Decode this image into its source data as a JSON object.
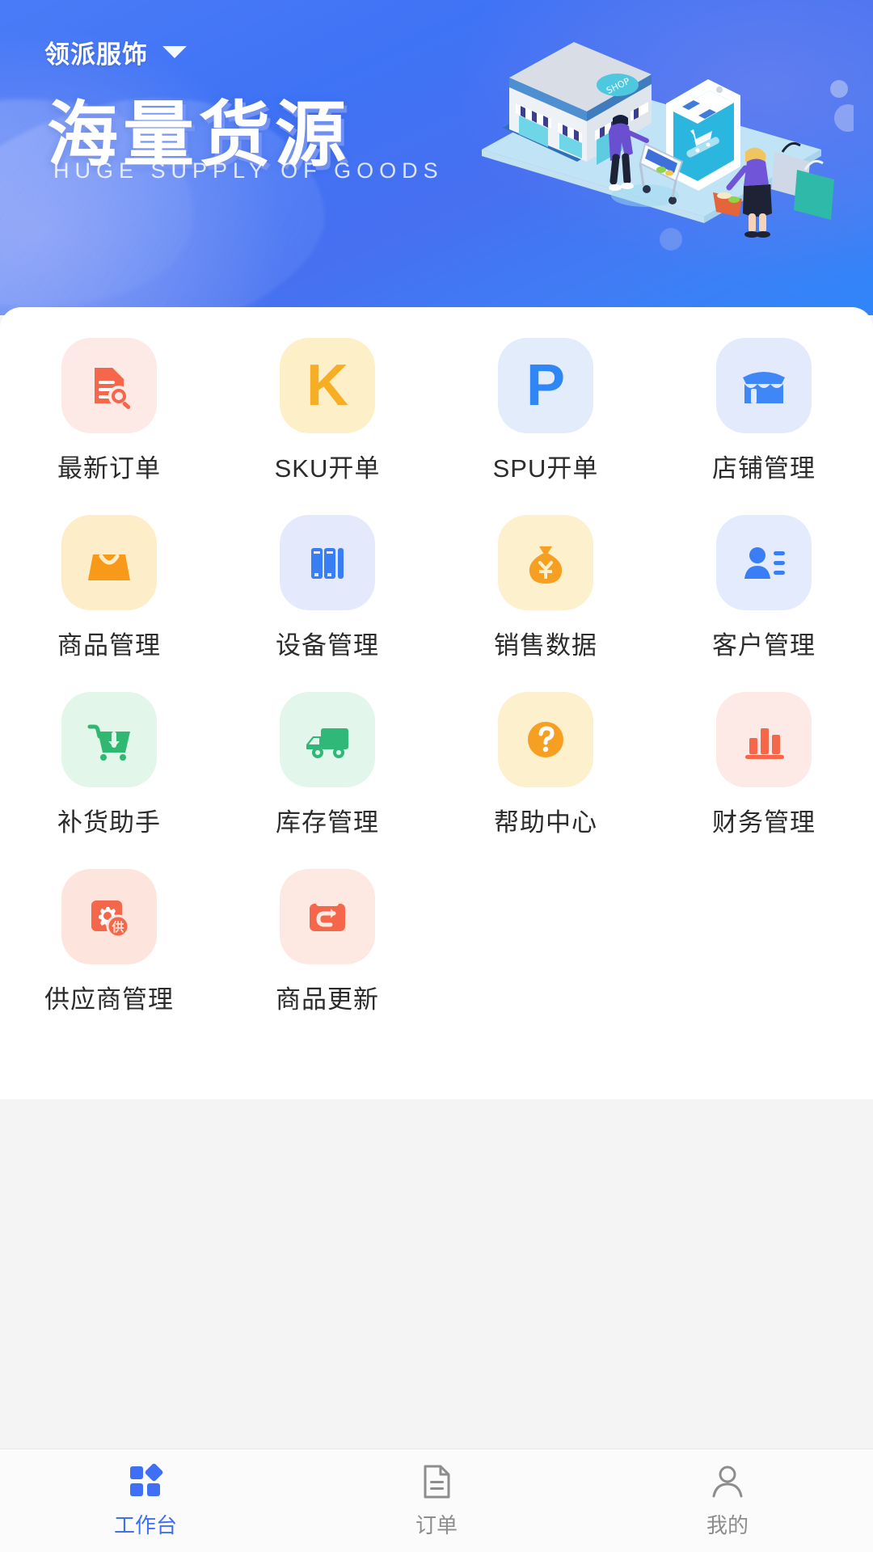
{
  "header": {
    "brand_name": "领派服饰",
    "brand_dropdown_icon": "chevron-down-icon",
    "title": "海量货源",
    "subtitle": "HUGE SUPPLY OF GOODS",
    "background_color": "#4372f3",
    "illustration": "isometric-shop-phone-shoppers"
  },
  "grid": {
    "items": [
      {
        "label": "最新订单",
        "icon": "document-search-icon",
        "icon_color": "#f5674a",
        "bg_color": "#fdeae6"
      },
      {
        "label": "SKU开单",
        "icon": "letter-k-icon",
        "icon_color": "#f7ae25",
        "bg_color": "#fdf0c8"
      },
      {
        "label": "SPU开单",
        "icon": "letter-p-icon",
        "icon_color": "#2f86f7",
        "bg_color": "#e3ecfb"
      },
      {
        "label": "店铺管理",
        "icon": "storefront-icon",
        "icon_color": "#3f86f7",
        "bg_color": "#e3eafb"
      },
      {
        "label": "商品管理",
        "icon": "shopping-bag-icon",
        "icon_color": "#f79a1a",
        "bg_color": "#fdeec9"
      },
      {
        "label": "设备管理",
        "icon": "binders-icon",
        "icon_color": "#3a7ef5",
        "bg_color": "#e4eafc"
      },
      {
        "label": "销售数据",
        "icon": "money-bag-yuan-icon",
        "icon_color": "#f79f22",
        "bg_color": "#fdf0cd"
      },
      {
        "label": "客户管理",
        "icon": "customer-contact-icon",
        "icon_color": "#3a7ef5",
        "bg_color": "#e4ebfc"
      },
      {
        "label": "补货助手",
        "icon": "cart-download-icon",
        "icon_color": "#2fb872",
        "bg_color": "#e2f6e9"
      },
      {
        "label": "库存管理",
        "icon": "delivery-truck-icon",
        "icon_color": "#2fb878",
        "bg_color": "#e2f6ec"
      },
      {
        "label": "帮助中心",
        "icon": "question-mark-icon",
        "icon_color": "#f79f22",
        "bg_color": "#fdf0cd"
      },
      {
        "label": "财务管理",
        "icon": "bar-chart-icon",
        "icon_color": "#f5674a",
        "bg_color": "#fde9e6"
      },
      {
        "label": "供应商管理",
        "icon": "supplier-gear-icon",
        "icon_color": "#f5674a",
        "bg_color": "#fde5de"
      },
      {
        "label": "商品更新",
        "icon": "product-refresh-icon",
        "icon_color": "#f5674a",
        "bg_color": "#fde8e2"
      }
    ]
  },
  "tabbar": {
    "items": [
      {
        "label": "工作台",
        "icon": "workbench-grid-icon",
        "active": true
      },
      {
        "label": "订单",
        "icon": "order-document-icon",
        "active": false
      },
      {
        "label": "我的",
        "icon": "user-profile-icon",
        "active": false
      }
    ],
    "active_color": "#3f6ff5",
    "inactive_color": "#8d8d8d"
  }
}
